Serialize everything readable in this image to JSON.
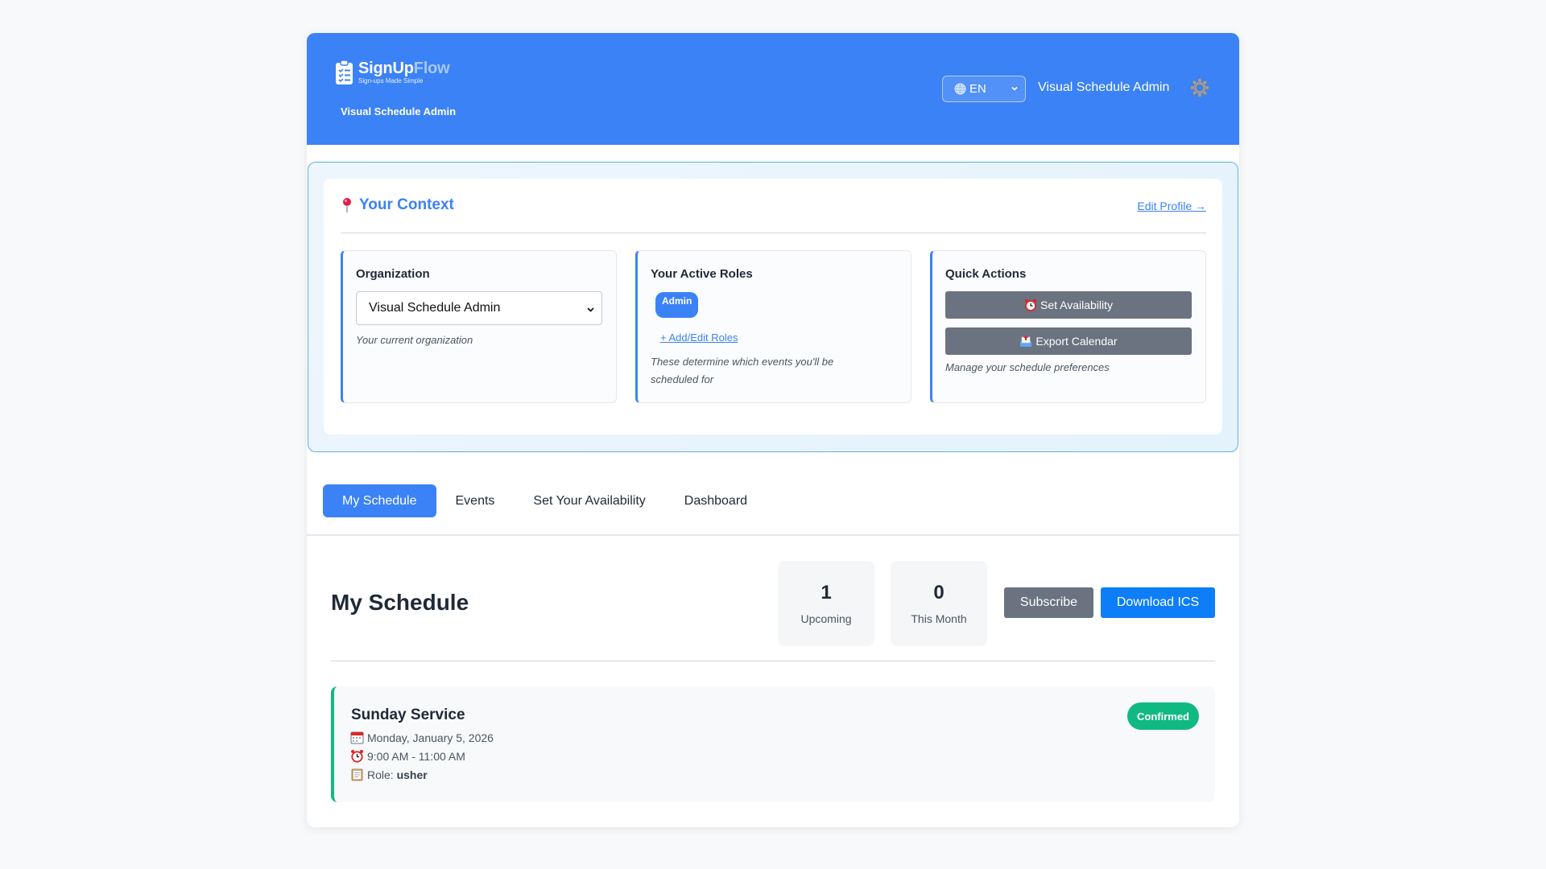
{
  "header": {
    "brand_main": "SignUp",
    "brand_accent": "Flow",
    "tagline": "Sign-ups Made Simple",
    "subtitle": "Visual Schedule Admin",
    "language": "EN",
    "user_name": "Visual Schedule Admin",
    "icons": [
      "clipboard-list-icon",
      "globe-icon",
      "gear-icon"
    ]
  },
  "context": {
    "title": "Your Context",
    "edit_profile": "Edit Profile →",
    "organization": {
      "title": "Organization",
      "selected": "Visual Schedule Admin",
      "hint": "Your current organization"
    },
    "roles": {
      "title": "Your Active Roles",
      "badges": [
        "Admin"
      ],
      "add_link": "+ Add/Edit Roles",
      "hint": "These determine which events you'll be scheduled for"
    },
    "quick_actions": {
      "title": "Quick Actions",
      "set_availability": "Set Availability",
      "export_calendar": "Export Calendar",
      "hint": "Manage your schedule preferences"
    }
  },
  "tabs": [
    {
      "label": "My Schedule",
      "active": true
    },
    {
      "label": "Events",
      "active": false
    },
    {
      "label": "Set Your Availability",
      "active": false
    },
    {
      "label": "Dashboard",
      "active": false
    }
  ],
  "schedule": {
    "title": "My Schedule",
    "stats": [
      {
        "value": "1",
        "label": "Upcoming"
      },
      {
        "value": "0",
        "label": "This Month"
      }
    ],
    "subscribe_label": "Subscribe",
    "download_label": "Download ICS",
    "events": [
      {
        "title": "Sunday Service",
        "date": "Monday, January 5, 2026",
        "time": "9:00 AM - 11:00 AM",
        "role_label": "Role:",
        "role": "usher",
        "status": "Confirmed"
      }
    ]
  },
  "colors": {
    "primary": "#3b82f6",
    "secondary_button": "#6b7280",
    "download_button": "#0d7ef8",
    "confirmed": "#10b981"
  }
}
